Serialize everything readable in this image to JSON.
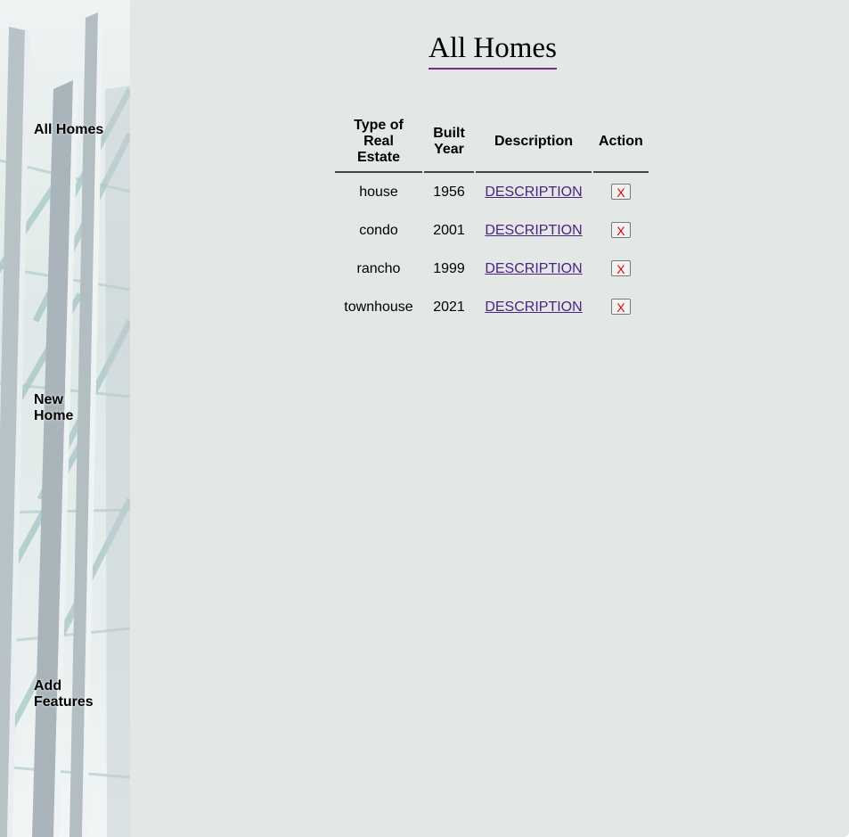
{
  "sidebar": {
    "nav": {
      "all_homes": "All Homes",
      "new_home": "New Home",
      "add_features": "Add Features"
    }
  },
  "main": {
    "title": "All Homes",
    "table": {
      "headers": {
        "type": "Type of Real Estate",
        "built_year": "Built Year",
        "description": "Description",
        "action": "Action"
      },
      "rows": [
        {
          "type": "house",
          "year": "1956",
          "description": "DESCRIPTION",
          "action": "X"
        },
        {
          "type": "condo",
          "year": "2001",
          "description": "DESCRIPTION",
          "action": "X"
        },
        {
          "type": "rancho",
          "year": "1999",
          "description": "DESCRIPTION",
          "action": "X"
        },
        {
          "type": "townhouse",
          "year": "2021",
          "description": "DESCRIPTION",
          "action": "X"
        }
      ]
    }
  },
  "colors": {
    "main_background": "#e3e7e6",
    "title_underline": "#7a2b82",
    "link": "#4b2480",
    "delete_text": "#e00000"
  }
}
